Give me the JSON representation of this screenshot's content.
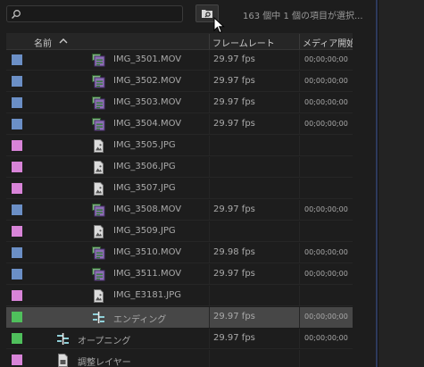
{
  "search": {
    "placeholder": "",
    "value": ""
  },
  "status": "163 個中 1 個の項目が選択...",
  "columns": {
    "name": "名前",
    "framerate": "フレームレート",
    "media_start": "メディア開始"
  },
  "colors": {
    "blue": "#6b8fc6",
    "pink": "#d884d8",
    "green": "#4fbf5c",
    "selected_row": "#474747"
  },
  "rows": [
    {
      "label": "blue",
      "icon": "clip-video-icon",
      "name": "IMG_3501.MOV",
      "fps": "29.97 fps",
      "start": "00;00;00;00",
      "selected": false
    },
    {
      "label": "blue",
      "icon": "clip-video-icon",
      "name": "IMG_3502.MOV",
      "fps": "29.97 fps",
      "start": "00;00;00;00",
      "selected": false
    },
    {
      "label": "blue",
      "icon": "clip-video-icon",
      "name": "IMG_3503.MOV",
      "fps": "29.97 fps",
      "start": "00;00;00;00",
      "selected": false
    },
    {
      "label": "blue",
      "icon": "clip-video-icon",
      "name": "IMG_3504.MOV",
      "fps": "29.97 fps",
      "start": "00;00;00;00",
      "selected": false
    },
    {
      "label": "pink",
      "icon": "still-image-icon",
      "name": "IMG_3505.JPG",
      "fps": "",
      "start": "",
      "selected": false
    },
    {
      "label": "pink",
      "icon": "still-image-icon",
      "name": "IMG_3506.JPG",
      "fps": "",
      "start": "",
      "selected": false
    },
    {
      "label": "pink",
      "icon": "still-image-icon",
      "name": "IMG_3507.JPG",
      "fps": "",
      "start": "",
      "selected": false
    },
    {
      "label": "blue",
      "icon": "clip-video-icon",
      "name": "IMG_3508.MOV",
      "fps": "29.97 fps",
      "start": "00;00;00;00",
      "selected": false
    },
    {
      "label": "pink",
      "icon": "still-image-icon",
      "name": "IMG_3509.JPG",
      "fps": "",
      "start": "",
      "selected": false
    },
    {
      "label": "blue",
      "icon": "clip-video-icon",
      "name": "IMG_3510.MOV",
      "fps": "29.98 fps",
      "start": "00;00;00;00",
      "selected": false
    },
    {
      "label": "blue",
      "icon": "clip-video-icon",
      "name": "IMG_3511.MOV",
      "fps": "29.97 fps",
      "start": "00;00;00;00",
      "selected": false
    },
    {
      "label": "pink",
      "icon": "still-image-icon",
      "name": "IMG_E3181.JPG",
      "fps": "",
      "start": "",
      "selected": false
    },
    {
      "label": "green",
      "icon": "sequence-icon",
      "name": "エンディング",
      "fps": "29.97 fps",
      "start": "00;00;00;00",
      "selected": true
    },
    {
      "label": "green",
      "icon": "sequence-icon",
      "name": "オープニング",
      "fps": "29.97 fps",
      "start": "00;00;00;00",
      "selected": false
    },
    {
      "label": "pink",
      "icon": "adjustment-layer-icon",
      "name": "調整レイヤー",
      "fps": "",
      "start": "",
      "selected": false
    }
  ]
}
